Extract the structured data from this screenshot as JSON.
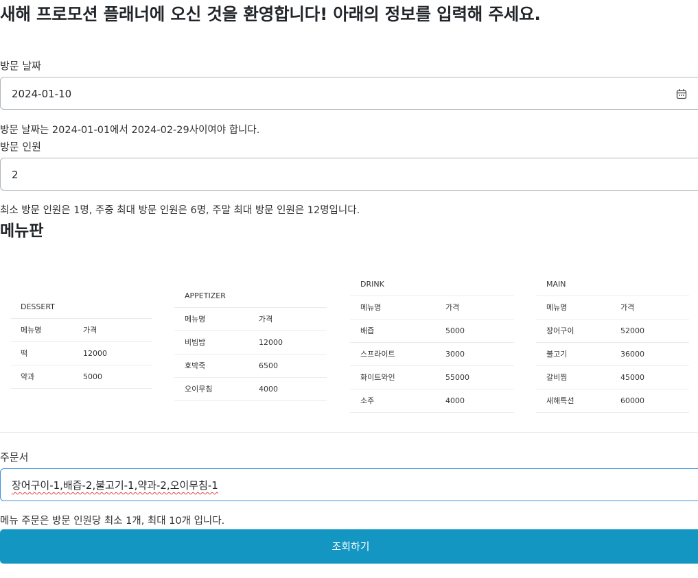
{
  "page": {
    "title": "새해 프로모션 플래너에 오신 것을 환영합니다! 아래의 정보를 입력해 주세요."
  },
  "visit_date": {
    "label": "방문 날짜",
    "value": "2024-01-10",
    "help": "방문 날짜는 2024-01-01에서 2024-02-29사이여야 합니다.",
    "icon": "calendar-icon"
  },
  "party_size": {
    "label": "방문 인원",
    "value": "2",
    "help": "최소 방문 인원은 1명, 주중 최대 방문 인원은 6명, 주말 최대 방문 인원은 12명입니다."
  },
  "menu": {
    "heading": "메뉴판",
    "columns": {
      "name": "메뉴명",
      "price": "가격"
    },
    "categories": [
      {
        "title": "DESSERT",
        "items": [
          {
            "name": "떡",
            "price": "12000"
          },
          {
            "name": "약과",
            "price": "5000"
          }
        ]
      },
      {
        "title": "APPETIZER",
        "items": [
          {
            "name": "비빔밥",
            "price": "12000"
          },
          {
            "name": "호박죽",
            "price": "6500"
          },
          {
            "name": "오이무침",
            "price": "4000"
          }
        ]
      },
      {
        "title": "DRINK",
        "items": [
          {
            "name": "배즙",
            "price": "5000"
          },
          {
            "name": "스프라이트",
            "price": "3000"
          },
          {
            "name": "화이트와인",
            "price": "55000"
          },
          {
            "name": "소주",
            "price": "4000"
          }
        ]
      },
      {
        "title": "MAIN",
        "items": [
          {
            "name": "장어구이",
            "price": "52000"
          },
          {
            "name": "불고기",
            "price": "36000"
          },
          {
            "name": "갈비찜",
            "price": "45000"
          },
          {
            "name": "새해특선",
            "price": "60000"
          }
        ]
      }
    ]
  },
  "order": {
    "label": "주문서",
    "value": "장어구이-1,배즙-2,불고기-1,약과-2,오이무침-1",
    "help": "메뉴 주문은 방문 인원당 최소 1개, 최대 10개 입니다."
  },
  "submit": {
    "label": "조회하기"
  },
  "colors": {
    "primary_button": "#1396c2",
    "input_border": "#adb5bd",
    "focus_border": "#3a8fd9"
  }
}
